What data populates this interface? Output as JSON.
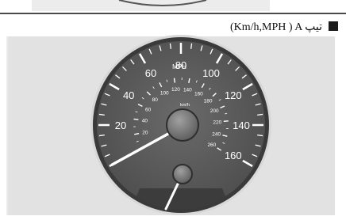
{
  "section": {
    "heading": "(Km/h,MPH ) A تیپ"
  },
  "speedometer": {
    "mph_unit": "MPH",
    "kmh_unit": "km/h",
    "mph_labels": [
      "20",
      "40",
      "60",
      "80",
      "100",
      "120",
      "140",
      "160"
    ],
    "kmh_labels": [
      "20",
      "40",
      "60",
      "80",
      "100",
      "120",
      "140",
      "160",
      "180",
      "200",
      "220",
      "240",
      "260"
    ],
    "needle_mph": 0
  },
  "colors": {
    "dial_face": "#595959",
    "dial_rim": "#3a3a3a",
    "markings": "#ffffff",
    "needle": "#ffffff",
    "hub": "#777777"
  }
}
